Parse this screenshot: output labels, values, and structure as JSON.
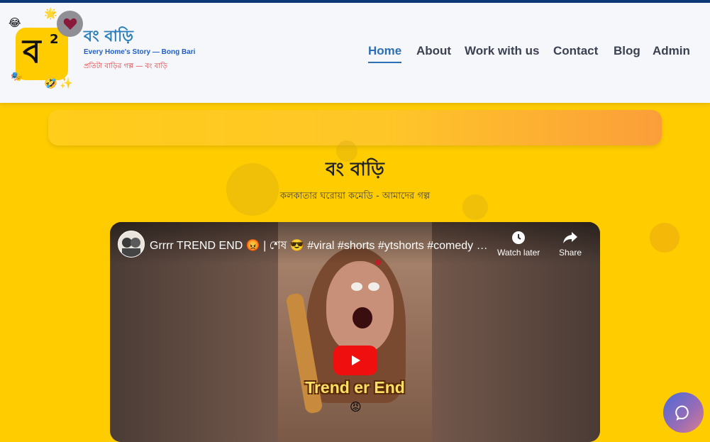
{
  "brand": {
    "logo_letter": "ব",
    "logo_superscript": "2",
    "title": "বং বাড়ি",
    "tagline_en": "Every Home's Story — Bong Bari",
    "tagline_bn": "প্রতিটা বাড়ির গল্প — বং বাড়ি",
    "decor_emojis": [
      "😂",
      "🌟",
      "🎭",
      "🤣",
      "✨"
    ]
  },
  "nav": {
    "items": [
      {
        "label": "Home",
        "active": true
      },
      {
        "label": "About",
        "active": false
      },
      {
        "label": "Work with us",
        "active": false
      },
      {
        "label": "Contact",
        "active": false
      },
      {
        "label": "Blog",
        "active": false
      },
      {
        "label": "Admin",
        "active": false
      }
    ]
  },
  "hero": {
    "title": "বং বাড়ি",
    "subtitle": "কলকাতার ঘরোয়া কমেডি - আমাদের গল্প"
  },
  "video": {
    "title": "Grrrr TREND END 😡 | শেষ 😎 #viral #shorts #ytshorts #comedy #...",
    "watch_later_label": "Watch later",
    "share_label": "Share",
    "overlay_text": "Trend er End",
    "overlay_emoji": "😡"
  },
  "colors": {
    "page_bg": "#ffcc00",
    "nav_active": "#2c6fb7",
    "play_red": "#f00f0f"
  }
}
